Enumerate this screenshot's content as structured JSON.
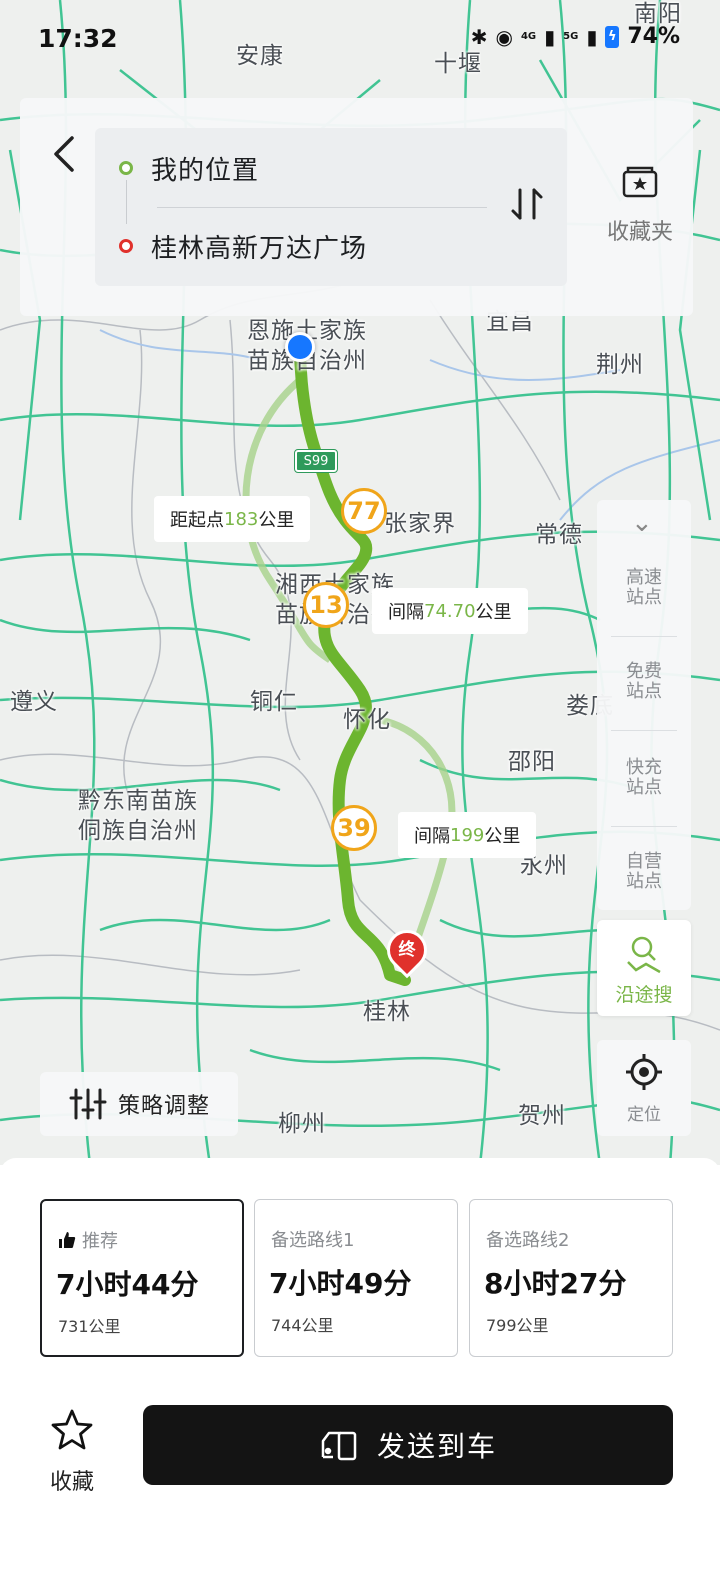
{
  "status_bar": {
    "time": "17:32",
    "battery": "74%",
    "net1": "4G",
    "net2": "5G"
  },
  "search": {
    "origin": "我的位置",
    "destination": "桂林高新万达广场",
    "favorites_folder": "收藏夹"
  },
  "map": {
    "cities": {
      "ankang": "安康",
      "shiyan": "十堰",
      "nanyang": "南阳",
      "enshi_line1": "恩施土家族",
      "enshi_line2": "苗族自治州",
      "jingzhou": "荆州",
      "zhangjiajie": "张家界",
      "changde": "常德",
      "xiangxi_line1": "湘西土家族",
      "xiangxi_line2": "苗族自治州",
      "zunyi": "遵义",
      "tongren": "铜仁",
      "huaihua": "怀化",
      "loudi": "娄底",
      "shaoyang": "邵阳",
      "qiandongnan_line1": "黔东南苗族",
      "qiandongnan_line2": "侗族自治州",
      "yongzhou": "永州",
      "guilin": "桂林",
      "liuzhou": "柳州",
      "hezhou": "贺州",
      "yichang": "宜昌"
    },
    "highway_shield": "S99",
    "callouts": {
      "c1_prefix": "距起点",
      "c1_value": "183",
      "c1_unit": "公里",
      "c2_prefix": "间隔",
      "c2_value": "74.70",
      "c2_unit": "公里",
      "c3_prefix": "间隔",
      "c3_value": "199",
      "c3_unit": "公里"
    },
    "markers": {
      "m1": "77",
      "m2": "13",
      "m3": "39",
      "end": "终"
    }
  },
  "rail": {
    "items": [
      "高速站点",
      "免费站点",
      "快充站点",
      "自营站点"
    ],
    "items_l1": [
      "高速",
      "免费",
      "快充",
      "自营"
    ],
    "items_l2": [
      "站点",
      "站点",
      "站点",
      "站点"
    ],
    "along_search": "沿途搜",
    "locate": "定位"
  },
  "strategy_label": "策略调整",
  "routes": [
    {
      "tag": "推荐",
      "duration": "7小时44分",
      "distance": "731公里"
    },
    {
      "tag": "备选路线1",
      "duration": "7小时49分",
      "distance": "744公里"
    },
    {
      "tag": "备选路线2",
      "duration": "8小时27分",
      "distance": "799公里"
    }
  ],
  "actions": {
    "favorite": "收藏",
    "send_to_car": "发送到车"
  },
  "colors": {
    "route_green": "#6cb52f",
    "traffic_green": "#2fc08a",
    "accent_red": "#e0312c",
    "marker_orange": "#f0a51a",
    "location_blue": "#1677ff"
  }
}
